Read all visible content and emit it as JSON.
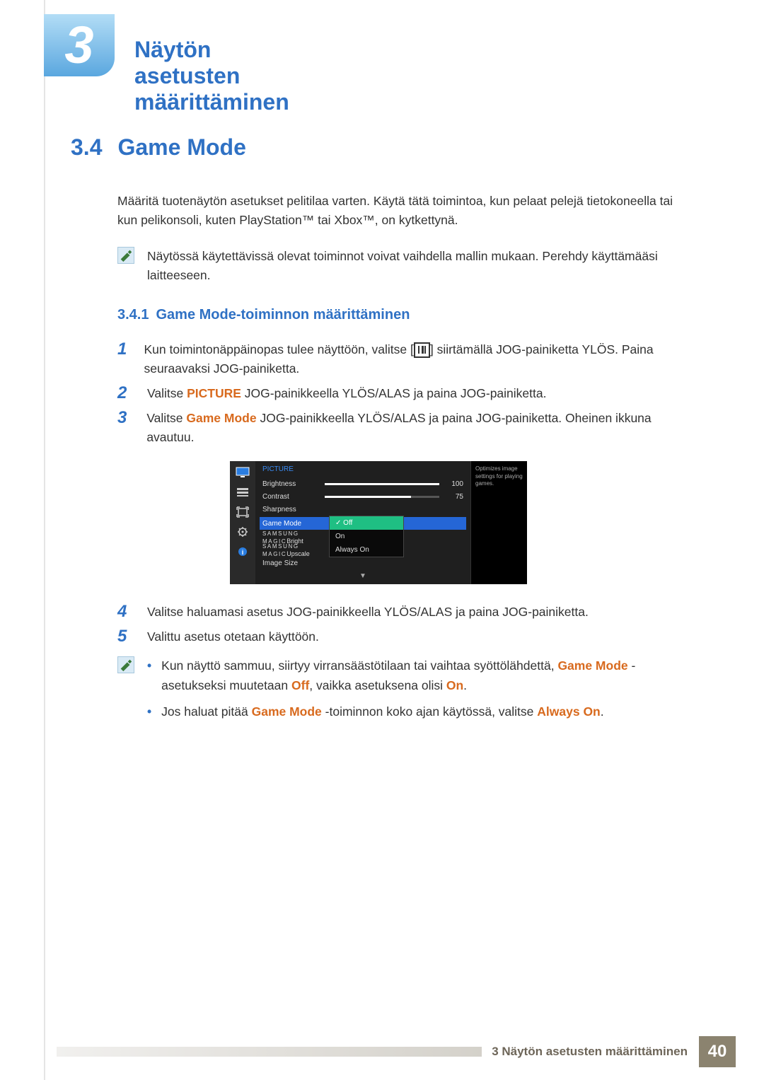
{
  "chapter": {
    "number": "3",
    "title": "Näytön asetusten määrittäminen"
  },
  "section": {
    "number": "3.4",
    "title": "Game Mode"
  },
  "intro": "Määritä tuotenäytön asetukset pelitilaa varten. Käytä tätä toimintoa, kun pelaat pelejä tietokoneella tai kun pelikonsoli, kuten PlayStation™ tai Xbox™, on kytkettynä.",
  "note1": "Näytössä käytettävissä olevat toiminnot voivat vaihdella mallin mukaan. Perehdy käyttämääsi laitteeseen.",
  "subsection": {
    "number": "3.4.1",
    "title": "Game Mode-toiminnon määrittäminen"
  },
  "steps": {
    "s1a": "Kun toimintonäppäinopas tulee näyttöön, valitse [",
    "s1b": "] siirtämällä JOG-painiketta YLÖS. Paina seuraavaksi JOG-painiketta.",
    "s2a": "Valitse ",
    "s2b": "PICTURE",
    "s2c": " JOG-painikkeella YLÖS/ALAS ja paina JOG-painiketta.",
    "s3a": "Valitse ",
    "s3b": "Game Mode",
    "s3c": " JOG-painikkeella YLÖS/ALAS ja paina JOG-painiketta. Oheinen ikkuna avautuu.",
    "s4": "Valitse haluamasi asetus JOG-painikkeella YLÖS/ALAS ja paina JOG-painiketta.",
    "s5": "Valittu asetus otetaan käyttöön."
  },
  "osd": {
    "title": "PICTURE",
    "brightness": {
      "label": "Brightness",
      "value": "100",
      "pct": 100
    },
    "contrast": {
      "label": "Contrast",
      "value": "75",
      "pct": 75
    },
    "sharpness": "Sharpness",
    "gamemode": "Game Mode",
    "magic_prefix": "SAMSUNG",
    "magic_bright": "MAGIC",
    "magic_bright_suffix": "Bright",
    "magic_upscale_suffix": "Upscale",
    "image_size": "Image Size",
    "popup": {
      "off": "Off",
      "on": "On",
      "always": "Always On"
    },
    "help": "Optimizes image settings for playing games."
  },
  "note2": {
    "b1a": "Kun näyttö sammuu, siirtyy virransäästötilaan tai vaihtaa syöttölähdettä, ",
    "b1b": "Game Mode",
    "b1c": " -asetukseksi muutetaan ",
    "b1d": "Off",
    "b1e": ", vaikka asetuksena olisi ",
    "b1f": "On",
    "b1g": ".",
    "b2a": "Jos haluat pitää ",
    "b2b": "Game Mode",
    "b2c": " -toiminnon koko ajan käytössä, valitse ",
    "b2d": "Always On",
    "b2e": "."
  },
  "footer": {
    "label": "3 Näytön asetusten määrittäminen",
    "page": "40"
  }
}
